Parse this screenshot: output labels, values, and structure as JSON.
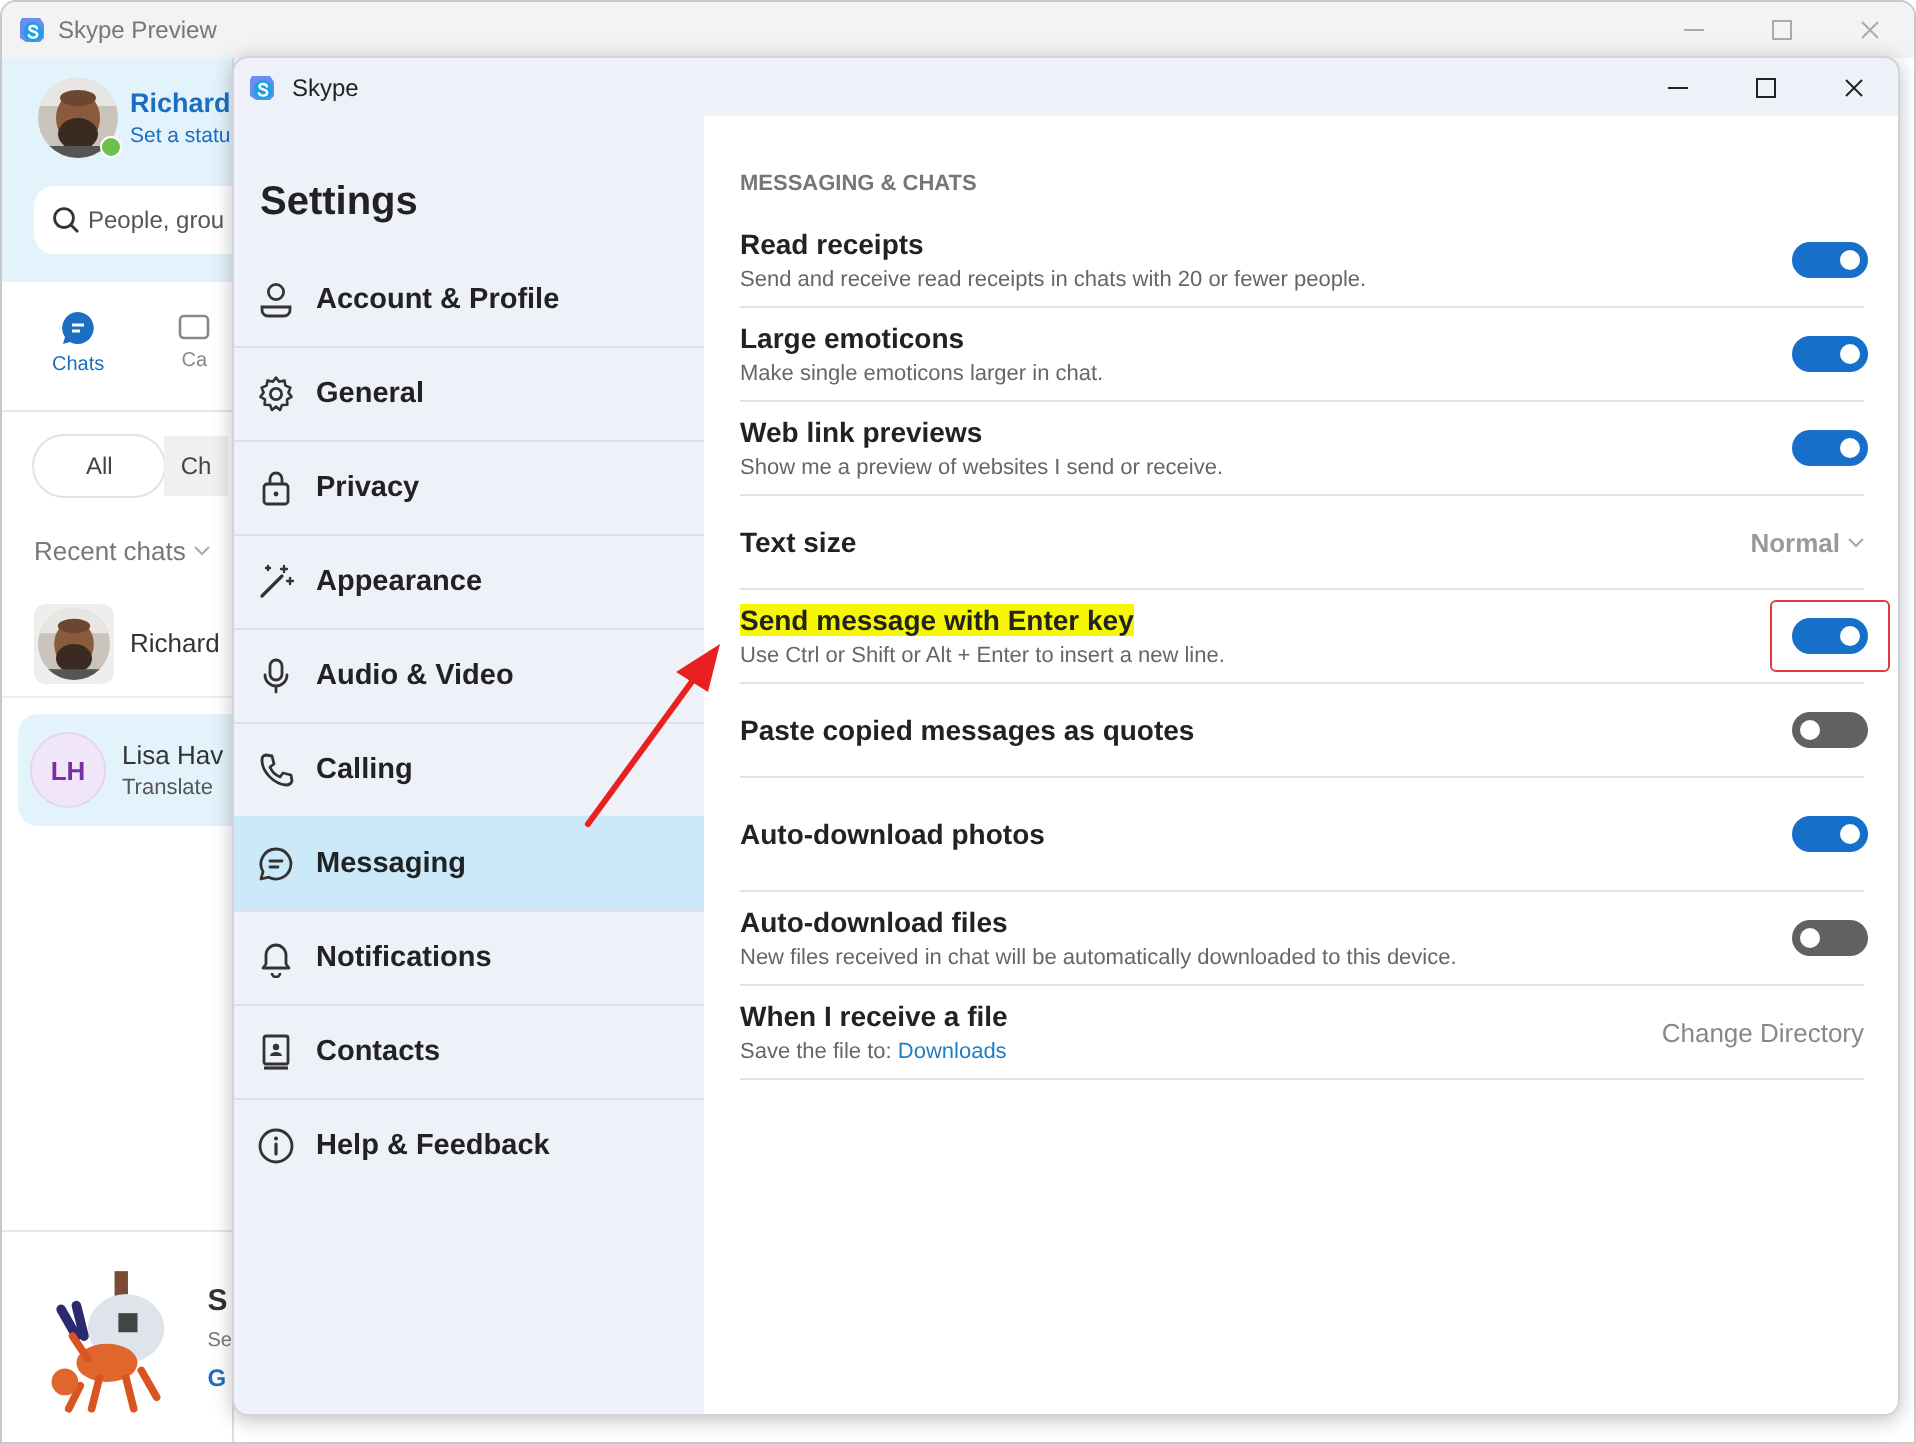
{
  "background_window": {
    "title": "Skype Preview",
    "profile": {
      "name": "Richard",
      "status": "Set a statu"
    },
    "search": {
      "placeholder": "People, grou"
    },
    "tabs": [
      {
        "label": "Chats",
        "selected": true
      },
      {
        "label": "Ca",
        "selected": false
      }
    ],
    "filters": [
      {
        "label": "All",
        "selected": true
      },
      {
        "label": "Ch",
        "selected": false
      }
    ],
    "recent_chats_label": "Recent chats",
    "chats": [
      {
        "name": "Richard",
        "selected": false
      },
      {
        "kind": "initials",
        "initials": "LH",
        "name": "Lisa Hav",
        "preview": "Translate",
        "selected": true
      }
    ],
    "promo": {
      "title": "S",
      "text": "Se",
      "link": "G"
    }
  },
  "settings_window": {
    "title": "Skype",
    "heading": "Settings",
    "nav": [
      {
        "label": "Account & Profile",
        "selected": false
      },
      {
        "label": "General",
        "selected": false
      },
      {
        "label": "Privacy",
        "selected": false
      },
      {
        "label": "Appearance",
        "selected": false
      },
      {
        "label": "Audio & Video",
        "selected": false
      },
      {
        "label": "Calling",
        "selected": false
      },
      {
        "label": "Messaging",
        "selected": true
      },
      {
        "label": "Notifications",
        "selected": false
      },
      {
        "label": "Contacts",
        "selected": false
      },
      {
        "label": "Help & Feedback",
        "selected": false
      }
    ],
    "section_title": "MESSAGING & CHATS",
    "rows": [
      {
        "kind": "toggle",
        "title": "Read receipts",
        "description": "Send and receive read receipts in chats with 20 or fewer people.",
        "on": true,
        "highlighted": false
      },
      {
        "kind": "toggle",
        "title": "Large emoticons",
        "description": "Make single emoticons larger in chat.",
        "on": true,
        "highlighted": false
      },
      {
        "kind": "toggle",
        "title": "Web link previews",
        "description": "Show me a preview of websites I send or receive.",
        "on": true,
        "highlighted": false
      },
      {
        "kind": "dropdown",
        "title": "Text size",
        "value": "Normal",
        "highlighted": false
      },
      {
        "kind": "toggle",
        "title": "Send message with Enter key",
        "description": "Use Ctrl or Shift or Alt + Enter to insert a new line.",
        "on": true,
        "highlighted": true
      },
      {
        "kind": "toggle",
        "title": "Paste copied messages as quotes",
        "on": false,
        "highlighted": false
      },
      {
        "kind": "toggle",
        "title": "Auto-download photos",
        "on": true,
        "highlighted": false
      },
      {
        "kind": "toggle",
        "title": "Auto-download files",
        "description": "New files received in chat will be automatically downloaded to this device.",
        "on": false,
        "highlighted": false
      },
      {
        "kind": "action",
        "title": "When I receive a file",
        "description": "Save the file to:",
        "link": "Downloads",
        "action": "Change Directory",
        "highlighted": false
      }
    ]
  }
}
